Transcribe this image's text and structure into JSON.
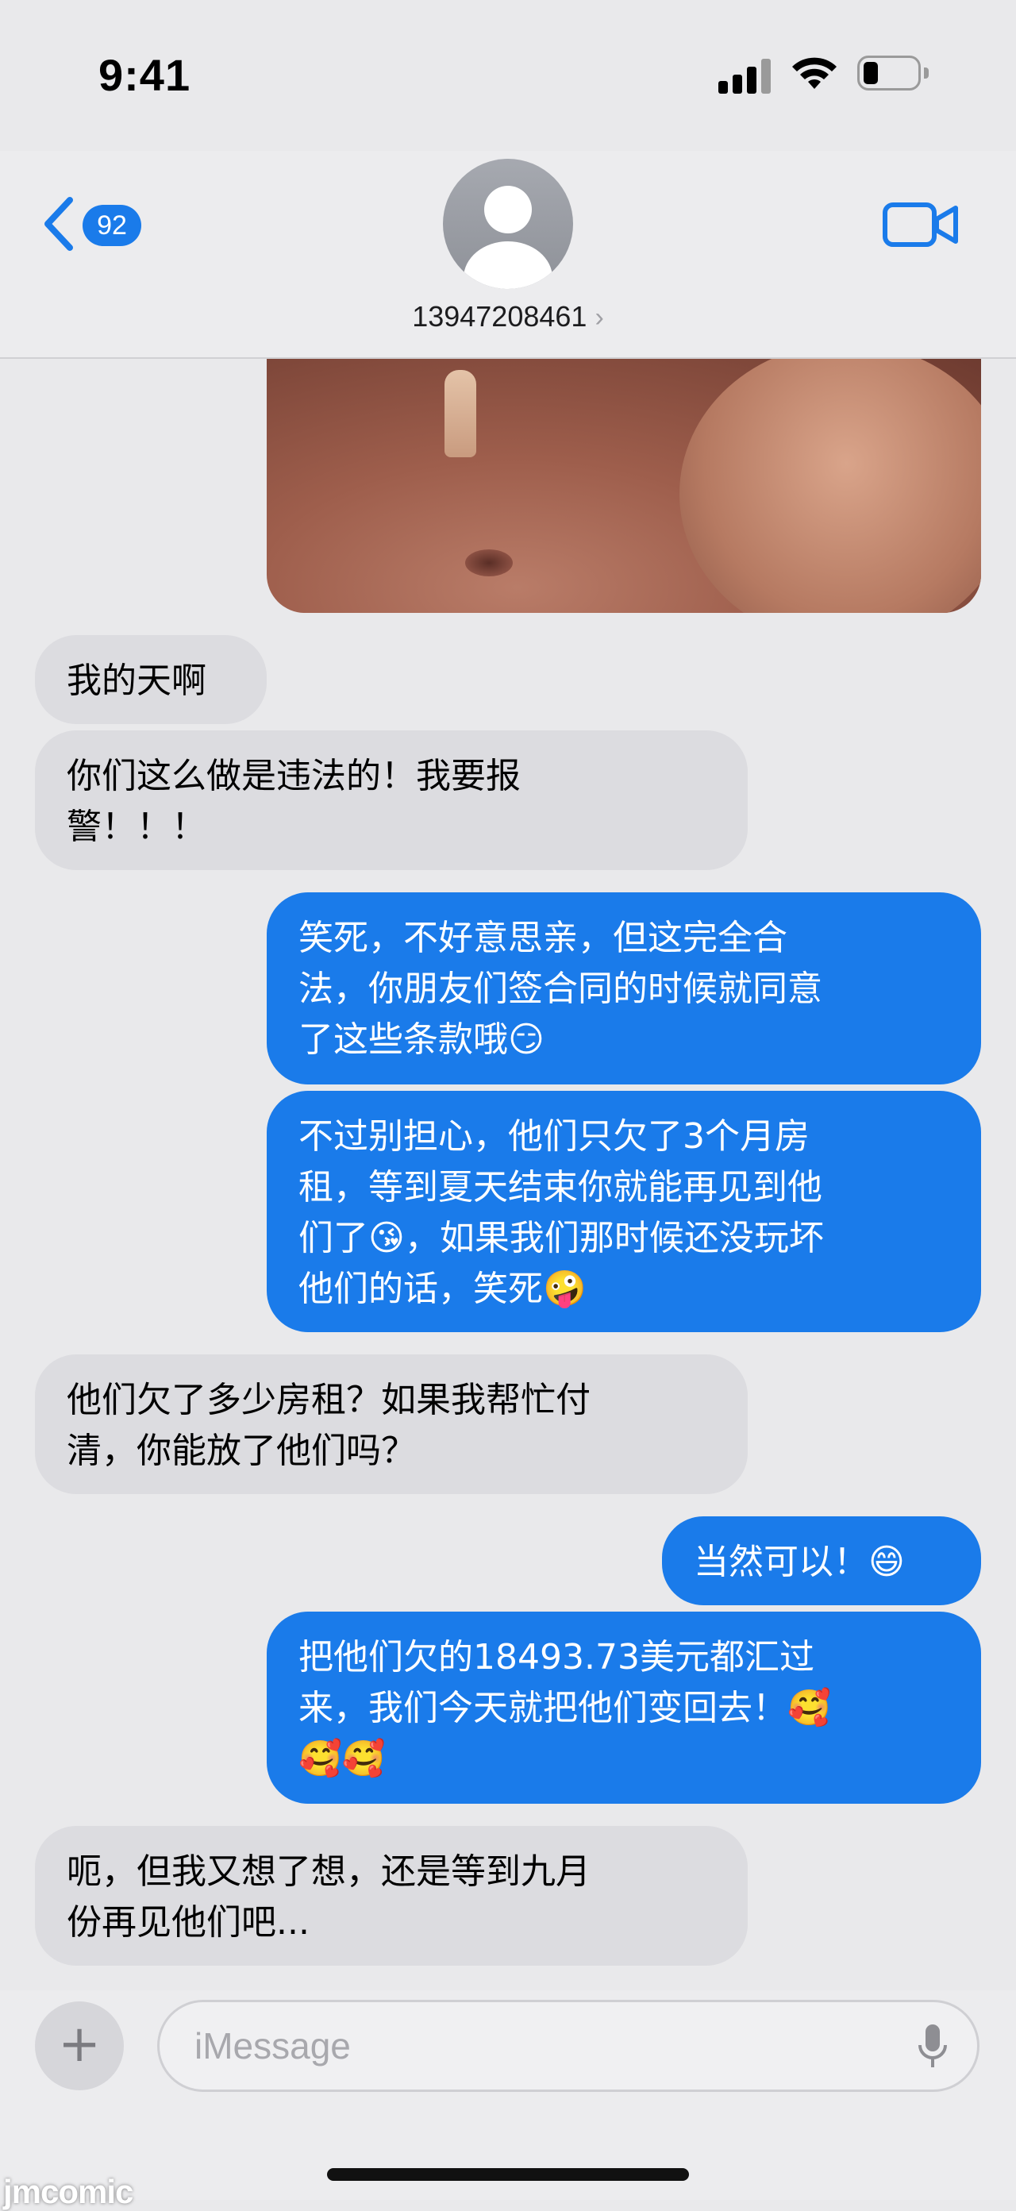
{
  "status_bar": {
    "time": "9:41"
  },
  "header": {
    "back_badge": "92",
    "contact": "13947208461",
    "contact_chevron": "›"
  },
  "messages": [
    {
      "direction": "received",
      "text": "我的天啊"
    },
    {
      "direction": "received",
      "text": "你们这么做是违法的！我要报\n警！！！"
    },
    {
      "direction": "sent",
      "text": "笑死，不好意思亲，但这完全合\n法，你朋友们签合同的时候就同意\n了这些条款哦😏"
    },
    {
      "direction": "sent",
      "text": "不过别担心，他们只欠了3个月房\n租，等到夏天结束你就能再见到他\n们了😘，如果我们那时候还没玩坏\n他们的话，笑死🤪"
    },
    {
      "direction": "received",
      "text": "他们欠了多少房租？如果我帮忙付\n清，你能放了他们吗？"
    },
    {
      "direction": "sent",
      "text": "当然可以！😄"
    },
    {
      "direction": "sent",
      "text": "把他们欠的18493.73美元都汇过\n来，我们今天就把他们变回去！🥰\n🥰🥰"
    },
    {
      "direction": "received",
      "text": "呃，但我又想了想，还是等到九月\n份再见他们吧..."
    }
  ],
  "input": {
    "plus_label": "+",
    "placeholder": "iMessage"
  },
  "watermark": "jmcomic",
  "colors": {
    "sent_bubble": "#1a7bea",
    "received_bubble": "#dcdce0",
    "accent": "#1a7bea"
  },
  "icons": {
    "back": "chevron-left-icon",
    "video": "video-camera-icon",
    "mic": "microphone-icon",
    "avatar": "person-silhouette-icon"
  }
}
